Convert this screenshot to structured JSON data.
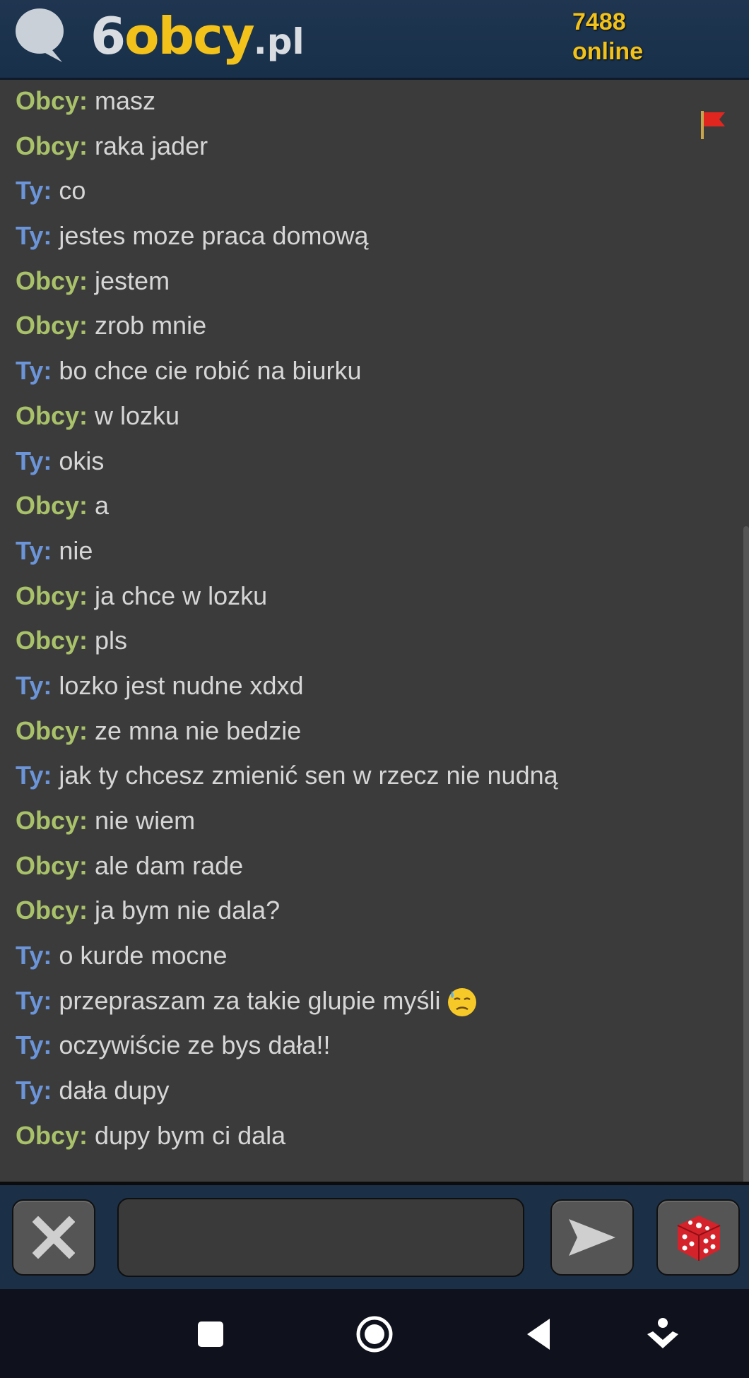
{
  "header": {
    "logo_six": "6",
    "logo_obcy": "obcy",
    "logo_pl": ".pl",
    "online_count": "7488",
    "online_label": "online"
  },
  "messages": [
    {
      "sender": "Obcy:",
      "who": "obcy",
      "text": "masz"
    },
    {
      "sender": "Obcy:",
      "who": "obcy",
      "text": "raka jader"
    },
    {
      "sender": "Ty:",
      "who": "ty",
      "text": "co"
    },
    {
      "sender": "Ty:",
      "who": "ty",
      "text": "jestes moze praca domową"
    },
    {
      "sender": "Obcy:",
      "who": "obcy",
      "text": "jestem"
    },
    {
      "sender": "Obcy:",
      "who": "obcy",
      "text": "zrob mnie"
    },
    {
      "sender": "Ty:",
      "who": "ty",
      "text": "bo chce cie robić na biurku"
    },
    {
      "sender": "Obcy:",
      "who": "obcy",
      "text": "w lozku"
    },
    {
      "sender": "Ty:",
      "who": "ty",
      "text": "okis"
    },
    {
      "sender": "Obcy:",
      "who": "obcy",
      "text": "a"
    },
    {
      "sender": "Ty:",
      "who": "ty",
      "text": "nie"
    },
    {
      "sender": "Obcy:",
      "who": "obcy",
      "text": "ja chce w lozku"
    },
    {
      "sender": "Obcy:",
      "who": "obcy",
      "text": "pls"
    },
    {
      "sender": "Ty:",
      "who": "ty",
      "text": "lozko jest nudne xdxd"
    },
    {
      "sender": "Obcy:",
      "who": "obcy",
      "text": "ze mna nie bedzie"
    },
    {
      "sender": "Ty:",
      "who": "ty",
      "text": "jak ty chcesz zmienić sen w rzecz nie nudną"
    },
    {
      "sender": "Obcy:",
      "who": "obcy",
      "text": "nie wiem"
    },
    {
      "sender": "Obcy:",
      "who": "obcy",
      "text": "ale dam rade"
    },
    {
      "sender": "Obcy:",
      "who": "obcy",
      "text": "ja bym nie dala?"
    },
    {
      "sender": "Ty:",
      "who": "ty",
      "text": "o kurde mocne"
    },
    {
      "sender": "Ty:",
      "who": "ty",
      "text": "przepraszam za takie glupie myśli",
      "emoji": "downcast-sweat-face"
    },
    {
      "sender": "Ty:",
      "who": "ty",
      "text": "oczywiście ze bys dała!!"
    },
    {
      "sender": "Ty:",
      "who": "ty",
      "text": "dała dupy"
    },
    {
      "sender": "Obcy:",
      "who": "obcy",
      "text": "dupy bym ci dala"
    }
  ],
  "composer": {
    "input_value": "",
    "input_placeholder": ""
  },
  "icons": {
    "disconnect": "close-x-icon",
    "send": "send-arrow-icon",
    "random": "dice-icon",
    "report": "red-flag-icon"
  },
  "colors": {
    "header_bg": "#1f3550",
    "accent_yellow": "#f2c21a",
    "stranger_name": "#a9c26a",
    "you_name": "#6b95d8",
    "chat_bg": "#3b3b3b"
  }
}
